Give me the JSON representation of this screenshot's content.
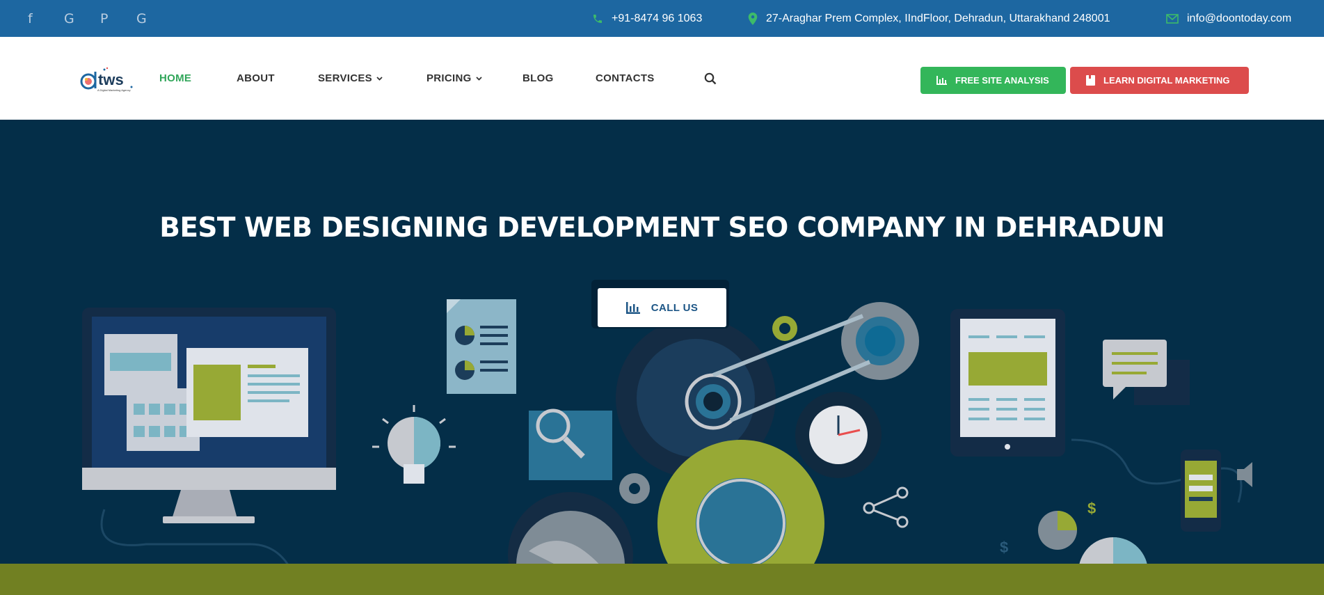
{
  "topbar": {
    "social_icons": [
      "facebook-icon",
      "google-icon",
      "pinterest-icon",
      "google-icon"
    ],
    "social_glyphs": [
      "f",
      "G",
      "P",
      "G"
    ],
    "phone": "+91-8474 96 1063",
    "address": "27-Araghar Prem Complex, IIndFloor, Dehradun, Uttarakhand 248001",
    "email": "info@doontoday.com"
  },
  "nav": {
    "logo_text": "dtws",
    "logo_tagline": "A Digital Marketing Agency",
    "items": [
      {
        "label": "HOME",
        "active": true
      },
      {
        "label": "ABOUT"
      },
      {
        "label": "SERVICES",
        "dropdown": true
      },
      {
        "label": "PRICING",
        "dropdown": true
      },
      {
        "label": "BLOG"
      },
      {
        "label": "CONTACTS"
      }
    ],
    "free_site_analysis": "FREE SITE ANALYSIS",
    "learn_digital_marketing": "LEARN DIGITAL MARKETING"
  },
  "hero": {
    "title": "BEST WEB DESIGNING DEVELOPMENT SEO COMPANY IN DEHRADUN",
    "call_label": "CALL US"
  },
  "colors": {
    "topbar": "#1d67a1",
    "active_nav": "#31a65a",
    "btn_green": "#33b65a",
    "btn_red": "#dc4c4c",
    "hero_bg": "#042e48",
    "band": "#718022"
  }
}
